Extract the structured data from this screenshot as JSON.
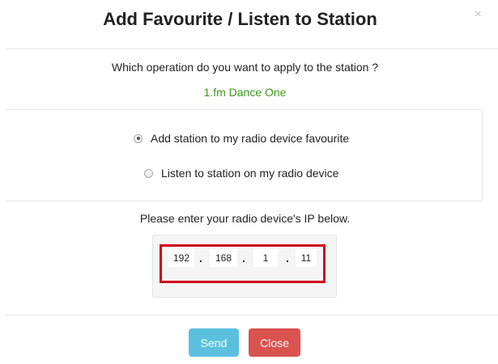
{
  "modal": {
    "title": "Add Favourite / Listen to Station",
    "close_glyph": "×"
  },
  "prompt": {
    "question": "Which operation do you want to apply to the station ?",
    "station_name": "1.fm Dance One"
  },
  "options": [
    {
      "label": "Add station to my radio device favourite",
      "checked": true
    },
    {
      "label": "Listen to station on my radio device",
      "checked": false
    }
  ],
  "ip": {
    "prompt": "Please enter your radio device's IP below.",
    "octets": [
      "192",
      "168",
      "1",
      "11"
    ],
    "separator": "."
  },
  "buttons": {
    "send": "Send",
    "close": "Close"
  },
  "colors": {
    "station": "#3c9a1c",
    "send": "#5bc0de",
    "close": "#d9534f",
    "highlight": "#d0021b"
  }
}
